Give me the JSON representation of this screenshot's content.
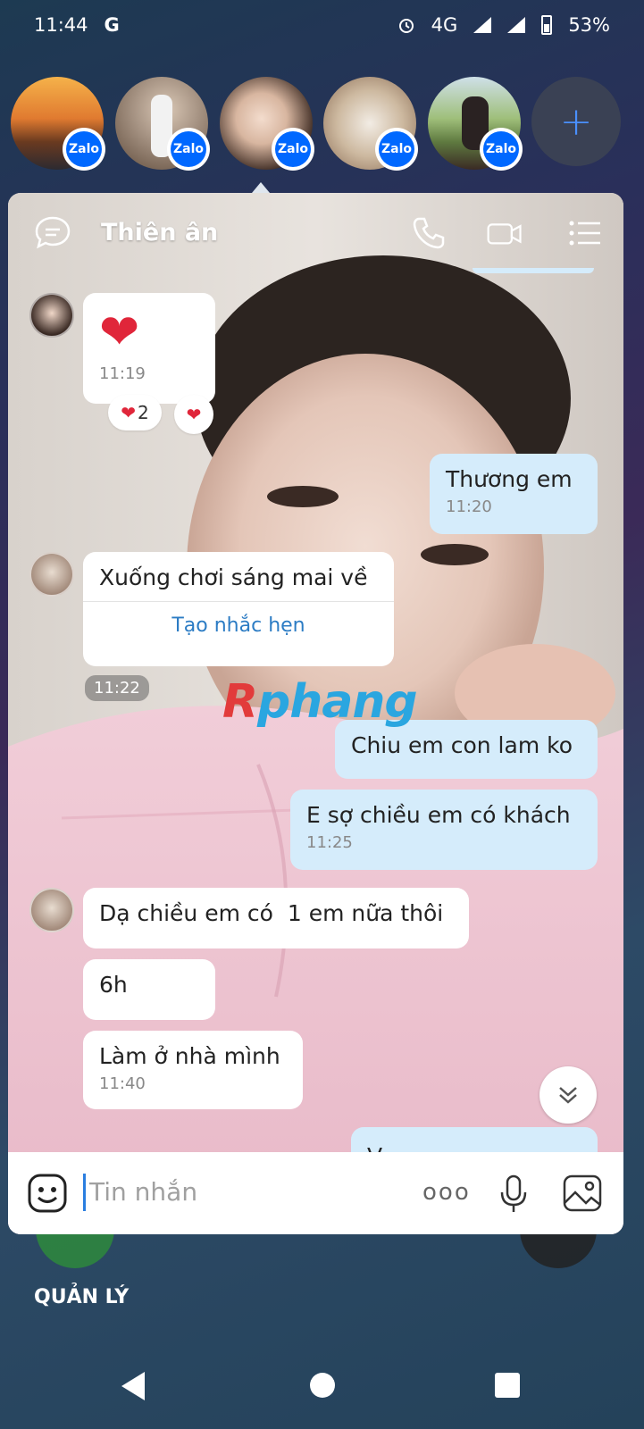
{
  "status_bar": {
    "time": "11:44",
    "google_icon": "G",
    "network": "4G",
    "battery": "53%"
  },
  "chat_heads": [
    {
      "name": "chathead-sunset",
      "badge": "Zalo",
      "colors": [
        "#f0a33a",
        "#5a3a28"
      ]
    },
    {
      "name": "chathead-woman-dress",
      "badge": "Zalo",
      "colors": [
        "#c7b7a8",
        "#6a5040"
      ]
    },
    {
      "name": "chathead-woman-smile",
      "badge": "Zalo",
      "colors": [
        "#e8cfc0",
        "#3b2a22"
      ]
    },
    {
      "name": "chathead-blurred",
      "badge": "Zalo",
      "colors": [
        "#e0d6c8",
        "#a88a70"
      ]
    },
    {
      "name": "chathead-woman-field",
      "badge": "Zalo",
      "colors": [
        "#9fbf7a",
        "#40302a"
      ]
    }
  ],
  "add_bubble": "+",
  "chat": {
    "title": "Thiên ân",
    "messages": {
      "heart_time": "11:19",
      "heart_reaction_count": "2",
      "thuong_em": "Thương em",
      "thuong_em_time": "11:20",
      "xuong_choi": "Xuống chơi sáng mai về",
      "tao_nhac_hen": "Tạo nhắc hẹn",
      "time_pill": "11:22",
      "chiu_em": "Chiu em con lam ko",
      "e_so": "E sợ chiều em có khách",
      "e_so_time": "11:25",
      "da_chieu": "Dạ chiều em có  1 em nữa thôi",
      "six_h": "6h",
      "lam_o": "Làm ở nhà mình",
      "lam_o_time": "11:40",
      "partial": "V"
    },
    "input_placeholder": "Tin nhắn",
    "more_dots": "ooo"
  },
  "watermark": {
    "r": "R",
    "rest": "phang"
  },
  "manage_label": "QUẢN LÝ",
  "icons": [
    "chat-icon",
    "phone-icon",
    "video-icon",
    "menu-icon",
    "emoji-icon",
    "mic-icon",
    "image-icon",
    "chevron-down-icon",
    "back-icon",
    "home-icon",
    "recents-icon"
  ],
  "colors": {
    "mine_bubble": "#d5ecfb",
    "other_bubble": "#ffffff",
    "link": "#2c7cc4",
    "zalo_blue": "#0068ff",
    "shirt_pink": "#eec6d3"
  }
}
